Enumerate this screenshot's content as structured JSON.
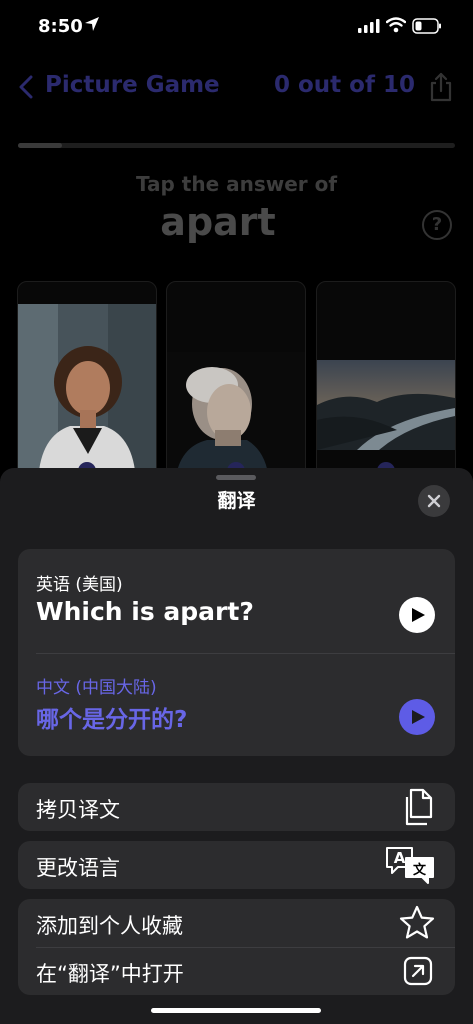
{
  "status": {
    "time": "8:50"
  },
  "nav": {
    "back_label": "Picture Game",
    "progress_text": "0 out of 10"
  },
  "game": {
    "progress_fraction": 0.1,
    "prompt": "Tap the answer of",
    "word": "apart",
    "help": "?"
  },
  "sheet": {
    "title": "翻译",
    "source": {
      "language": "英语 (美国)",
      "text": "Which is apart?"
    },
    "target": {
      "language": "中文 (中国大陆)",
      "text": "哪个是分开的?"
    },
    "actions": {
      "copy": "拷贝译文",
      "change_language": "更改语言",
      "add_favorite": "添加到个人收藏",
      "open_in_translate": "在“翻译”中打开"
    },
    "translate_icon_glyphs": {
      "a": "A",
      "b": "文"
    }
  },
  "colors": {
    "accent": "#5e5ce6",
    "nav_text": "#2b2a6e",
    "sheet_bg": "#1c1c1e",
    "card_bg": "#2c2c2e"
  }
}
